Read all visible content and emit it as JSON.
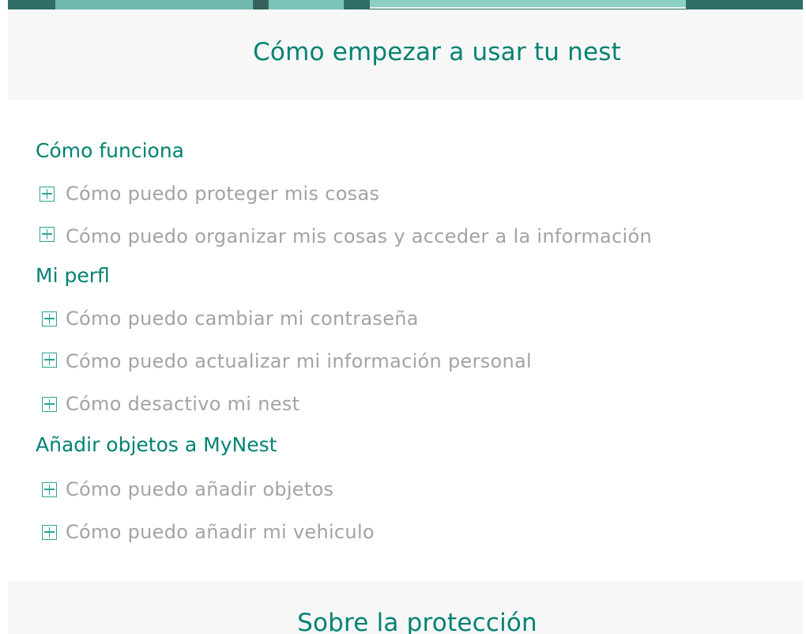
{
  "sections": [
    {
      "title": "Cómo empezar a usar tu nest",
      "groups": [
        {
          "title": "Cómo funciona",
          "items": [
            "Cómo puedo proteger mis cosas",
            "Cómo puedo organizar mis cosas y acceder a la información"
          ]
        },
        {
          "title": "Mi perfl",
          "items": [
            "Cómo puedo cambiar mi contraseña",
            "Cómo puedo actualizar mi información personal",
            "Cómo desactivo mi nest"
          ]
        },
        {
          "title": "Añadir objetos a MyNest",
          "items": [
            "Cómo puedo añadir objetos",
            "Cómo puedo añadir mi vehiculo"
          ]
        }
      ]
    },
    {
      "title": "Sobre la protección"
    }
  ],
  "icons": {
    "expand": "plus-square-icon"
  },
  "colors": {
    "accent": "#008272",
    "icon": "#2aa394",
    "item_text": "#a3a3a3",
    "header_bg": "#f7f7f7"
  }
}
